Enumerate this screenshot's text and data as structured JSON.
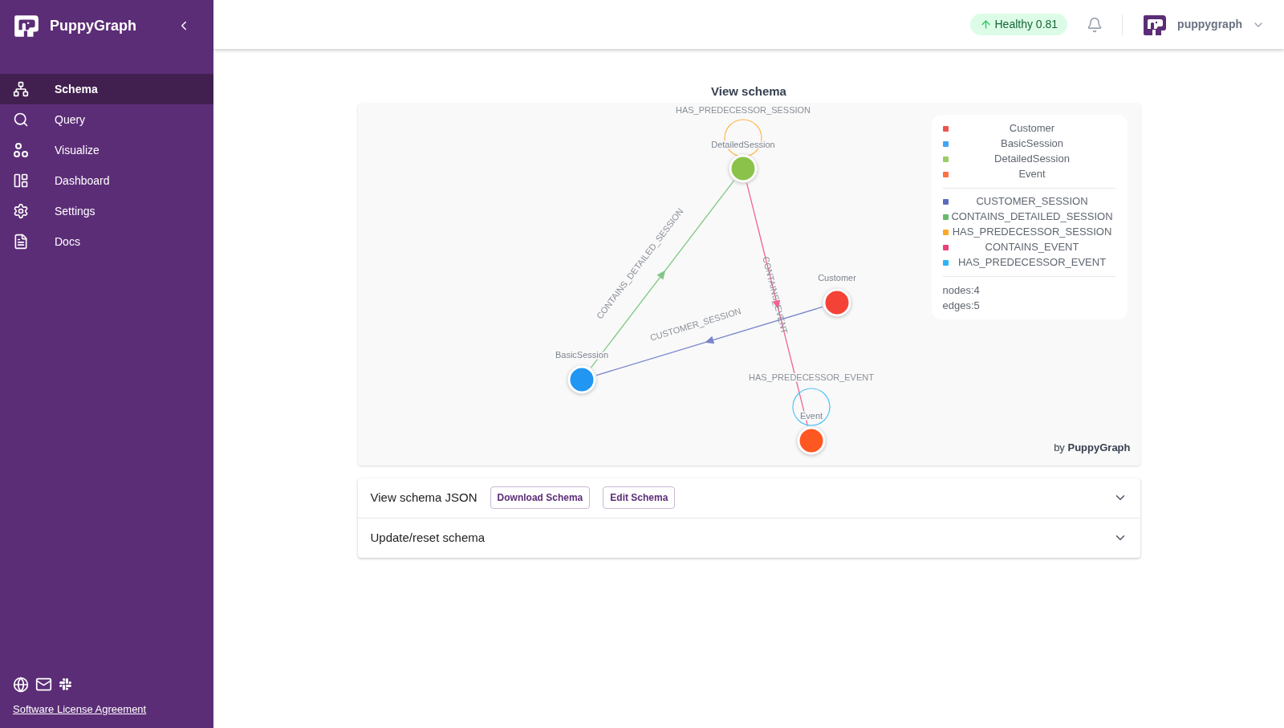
{
  "sidebar": {
    "brand": "PuppyGraph",
    "items": [
      {
        "label": "Schema",
        "selected": true
      },
      {
        "label": "Query",
        "selected": false
      },
      {
        "label": "Visualize",
        "selected": false
      },
      {
        "label": "Dashboard",
        "selected": false
      },
      {
        "label": "Settings",
        "selected": false
      },
      {
        "label": "Docs",
        "selected": false
      }
    ],
    "footer_link": "Software License Agreement"
  },
  "header": {
    "health": "Healthy 0.81",
    "user": "puppygraph"
  },
  "schema": {
    "title": "View schema",
    "graph": {
      "nodes": [
        {
          "label": "Customer",
          "color": "#f44336"
        },
        {
          "label": "BasicSession",
          "color": "#2196f3"
        },
        {
          "label": "DetailedSession",
          "color": "#8bc34a"
        },
        {
          "label": "Event",
          "color": "#ff5722"
        }
      ],
      "edges": [
        {
          "label": "CUSTOMER_SESSION",
          "color": "#7986cb"
        },
        {
          "label": "CONTAINS_DETAILED_SESSION",
          "color": "#81c784"
        },
        {
          "label": "HAS_PREDECESSOR_SESSION",
          "color": "#ffb74d"
        },
        {
          "label": "CONTAINS_EVENT",
          "color": "#f06292"
        },
        {
          "label": "HAS_PREDECESSOR_EVENT",
          "color": "#4fc3f7"
        }
      ]
    },
    "legend": {
      "node_types": [
        {
          "label": "Customer",
          "color": "#ef5350"
        },
        {
          "label": "BasicSession",
          "color": "#42a5f5"
        },
        {
          "label": "DetailedSession",
          "color": "#9ccc65"
        },
        {
          "label": "Event",
          "color": "#ff7043"
        }
      ],
      "edge_types": [
        {
          "label": "CUSTOMER_SESSION",
          "color": "#5c6bc0"
        },
        {
          "label": "CONTAINS_DETAILED_SESSION",
          "color": "#66bb6a"
        },
        {
          "label": "HAS_PREDECESSOR_SESSION",
          "color": "#ffa726"
        },
        {
          "label": "CONTAINS_EVENT",
          "color": "#ec407a"
        },
        {
          "label": "HAS_PREDECESSOR_EVENT",
          "color": "#29b6f6"
        }
      ],
      "stats": [
        "nodes:4",
        "edges:5"
      ]
    },
    "credit": "by **PuppyGraph**"
  },
  "accordion": [
    {
      "title": "View schema JSON",
      "expanded": false,
      "buttons": [
        "Download Schema",
        "Edit Schema"
      ]
    },
    {
      "title": "Update/reset schema",
      "expanded": false
    }
  ]
}
